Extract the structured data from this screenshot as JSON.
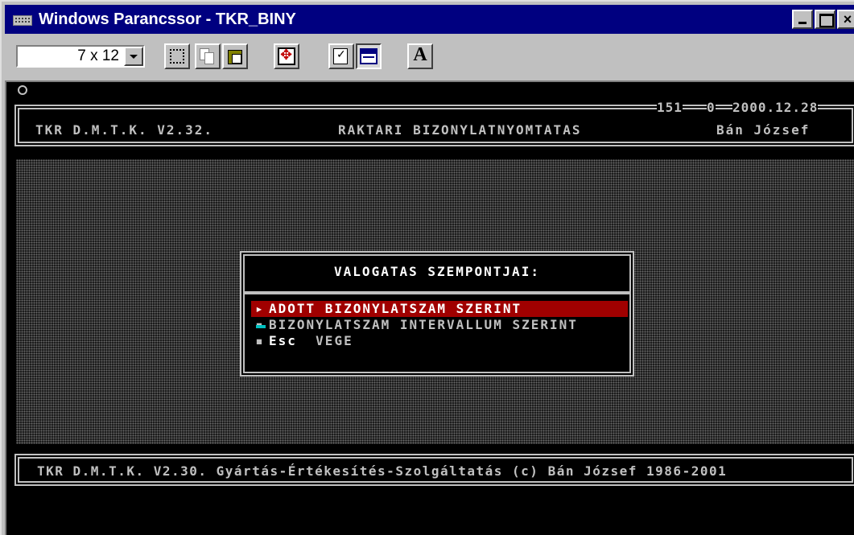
{
  "window": {
    "title": "Windows Parancssor - TKR_BINY",
    "min_symbol": "",
    "max_symbol": "",
    "close_symbol": "×"
  },
  "toolbar": {
    "font_size_value": "7 x 12",
    "tools": [
      "mark-tool",
      "copy-tool",
      "paste-tool",
      "fullscreen-tool",
      "properties-tool",
      "background-tool",
      "font-tool"
    ],
    "font_letter": "A"
  },
  "console": {
    "header": {
      "left": "TKR D.M.T.K. V2.32.",
      "center": "RAKTARI BIZONYLATNYOMTATAS",
      "right": "Bán József",
      "counter1": "151",
      "counter2": "0",
      "date": "2000.12.28"
    },
    "menu": {
      "title": "VALOGATAS SZEMPONTJAI:",
      "items": [
        {
          "mark": "▸",
          "key": "",
          "label": "ADOTT BIZONYLATSZAM SZERINT"
        },
        {
          "mark": "▪",
          "key": "",
          "label": "BIZONYLATSZAM INTERVALLUM SZERINT"
        },
        {
          "mark": "▪",
          "key": "Esc",
          "label": "VEGE"
        }
      ]
    },
    "footer": "TKR D.M.T.K. V2.30. Gyártás-Értékesítés-Szolgáltatás (c) Bán József 1986-2001"
  },
  "colors": {
    "titlebar": "#000080",
    "selection": "#a00000",
    "console_text": "#c0c0c0",
    "cursor": "#00c0c0"
  }
}
